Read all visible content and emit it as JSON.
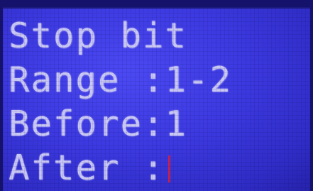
{
  "screen": {
    "line1": "Stop bit",
    "line2": "Range :1-2",
    "line3": "Before:1",
    "line4": "After :"
  },
  "colors": {
    "background": "#3c39e0",
    "text": "#c9c7f4",
    "cursor": "#e0203a"
  }
}
